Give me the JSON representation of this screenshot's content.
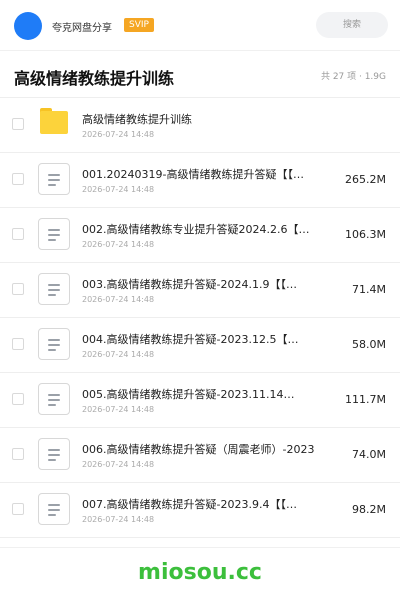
{
  "header": {
    "app_name": "夸克网盘分享",
    "badge": "SVIP",
    "search_placeholder": "搜索"
  },
  "folder": {
    "title": "高级情绪教练提升训练",
    "meta": "共 27 项 · 1.9G"
  },
  "items": [
    {
      "type": "folder",
      "name": "高级情绪教练提升训练",
      "date": "2026-07-24 14:48",
      "size": ""
    },
    {
      "type": "file",
      "name": "001.20240319-高级情绪教练提升答疑【【…",
      "date": "2026-07-24 14:48",
      "size": "265.2M"
    },
    {
      "type": "file",
      "name": "002.高级情绪教练专业提升答疑2024.2.6【…",
      "date": "2026-07-24 14:48",
      "size": "106.3M"
    },
    {
      "type": "file",
      "name": "003.高级情绪教练提升答疑-2024.1.9【【…",
      "date": "2026-07-24 14:48",
      "size": "71.4M"
    },
    {
      "type": "file",
      "name": "004.高级情绪教练提升答疑-2023.12.5【…",
      "date": "2026-07-24 14:48",
      "size": "58.0M"
    },
    {
      "type": "file",
      "name": "005.高级情绪教练提升答疑-2023.11.14…",
      "date": "2026-07-24 14:48",
      "size": "111.7M"
    },
    {
      "type": "file",
      "name": "006.高级情绪教练提升答疑（周震老师）-2023…",
      "date": "2026-07-24 14:48",
      "size": "74.0M"
    },
    {
      "type": "file",
      "name": "007.高级情绪教练提升答疑-2023.9.4【【…",
      "date": "2026-07-24 14:48",
      "size": "98.2M"
    }
  ],
  "watermark": "miosou.cc",
  "colors": {
    "avatar": "#1f7cf7",
    "badge": "#f5a623",
    "folder": "#fcd33b",
    "watermark": "#3cbf3c"
  }
}
